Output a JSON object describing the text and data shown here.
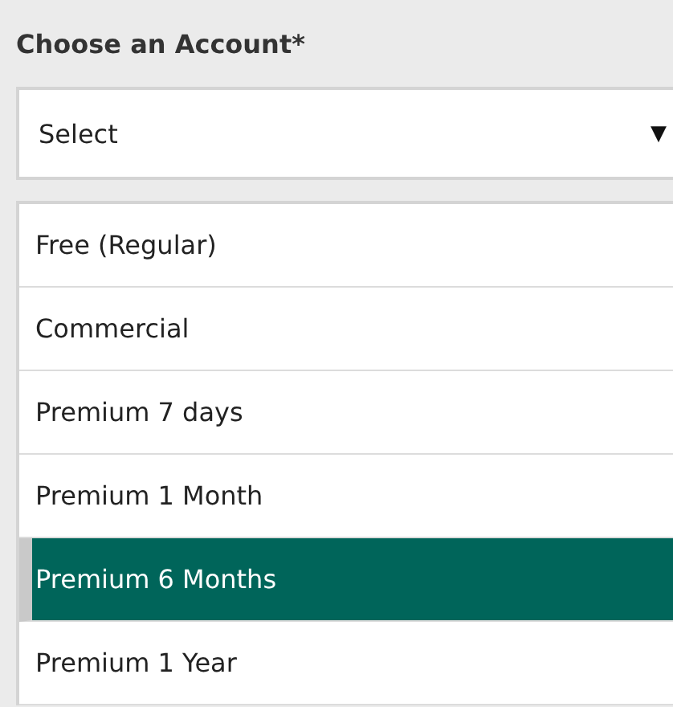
{
  "field": {
    "label": "Choose an Account*",
    "value": "Select",
    "caret": "▼",
    "expanded": true
  },
  "options": [
    {
      "label": "Free (Regular)",
      "selected": false
    },
    {
      "label": "Commercial",
      "selected": false
    },
    {
      "label": "Premium 7 days",
      "selected": false
    },
    {
      "label": "Premium 1 Month",
      "selected": false
    },
    {
      "label": "Premium 6 Months",
      "selected": true
    },
    {
      "label": "Premium 1 Year",
      "selected": false
    }
  ]
}
